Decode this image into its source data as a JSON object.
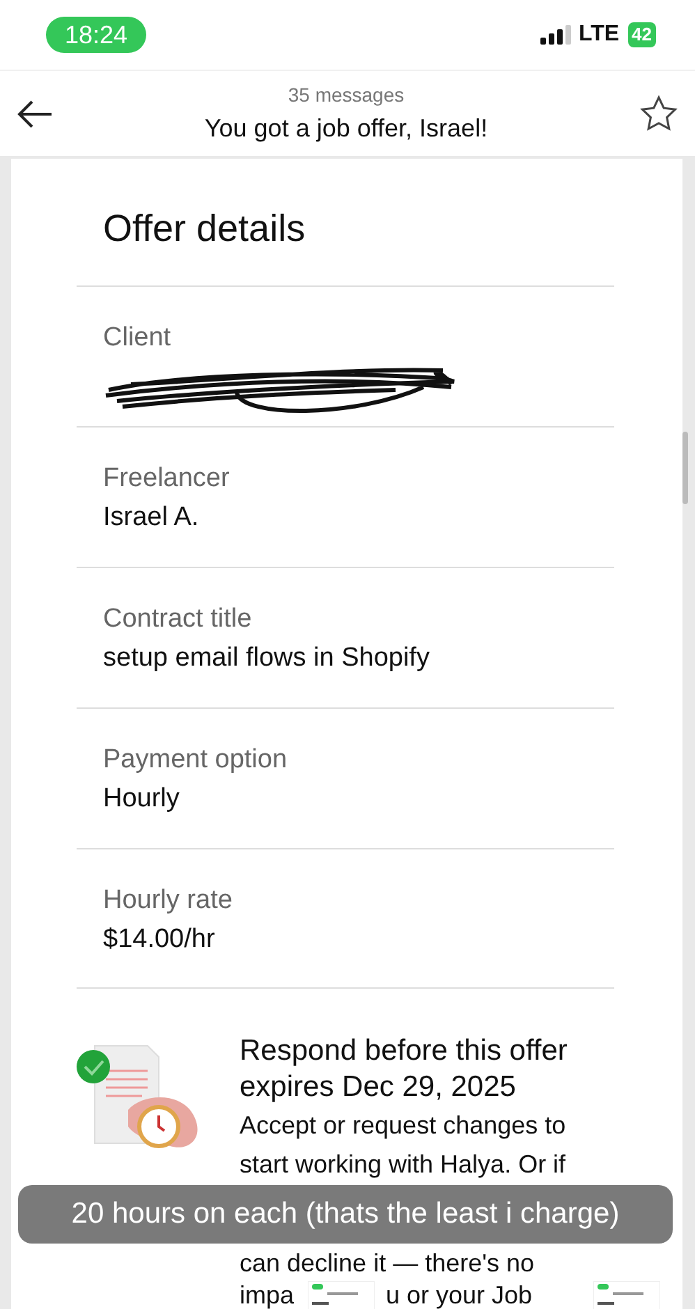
{
  "status_bar": {
    "time": "18:24",
    "network": "LTE",
    "battery": "42"
  },
  "header": {
    "count": "35 messages",
    "subject": "You got a job offer, Israel!",
    "starred": false
  },
  "offer": {
    "title": "Offer details",
    "fields": [
      {
        "label": "Client",
        "kind": "redacted"
      },
      {
        "label": "Freelancer",
        "value": "Israel A."
      },
      {
        "label": "Contract title",
        "value": "setup email flows in Shopify"
      },
      {
        "label": "Payment option",
        "value": "Hourly"
      },
      {
        "label": "Hourly rate",
        "value": "$14.00/hr"
      }
    ]
  },
  "notice": {
    "heading": "Respond before this offer expires Dec 29, 2025",
    "lines": [
      "Accept or request changes to",
      "start working with Halya. Or if"
    ],
    "after_caption": "can decline it — there's no",
    "last_line": [
      "impa",
      "u or your Job"
    ]
  },
  "caption": "20 hours on each (thats the least i charge)"
}
